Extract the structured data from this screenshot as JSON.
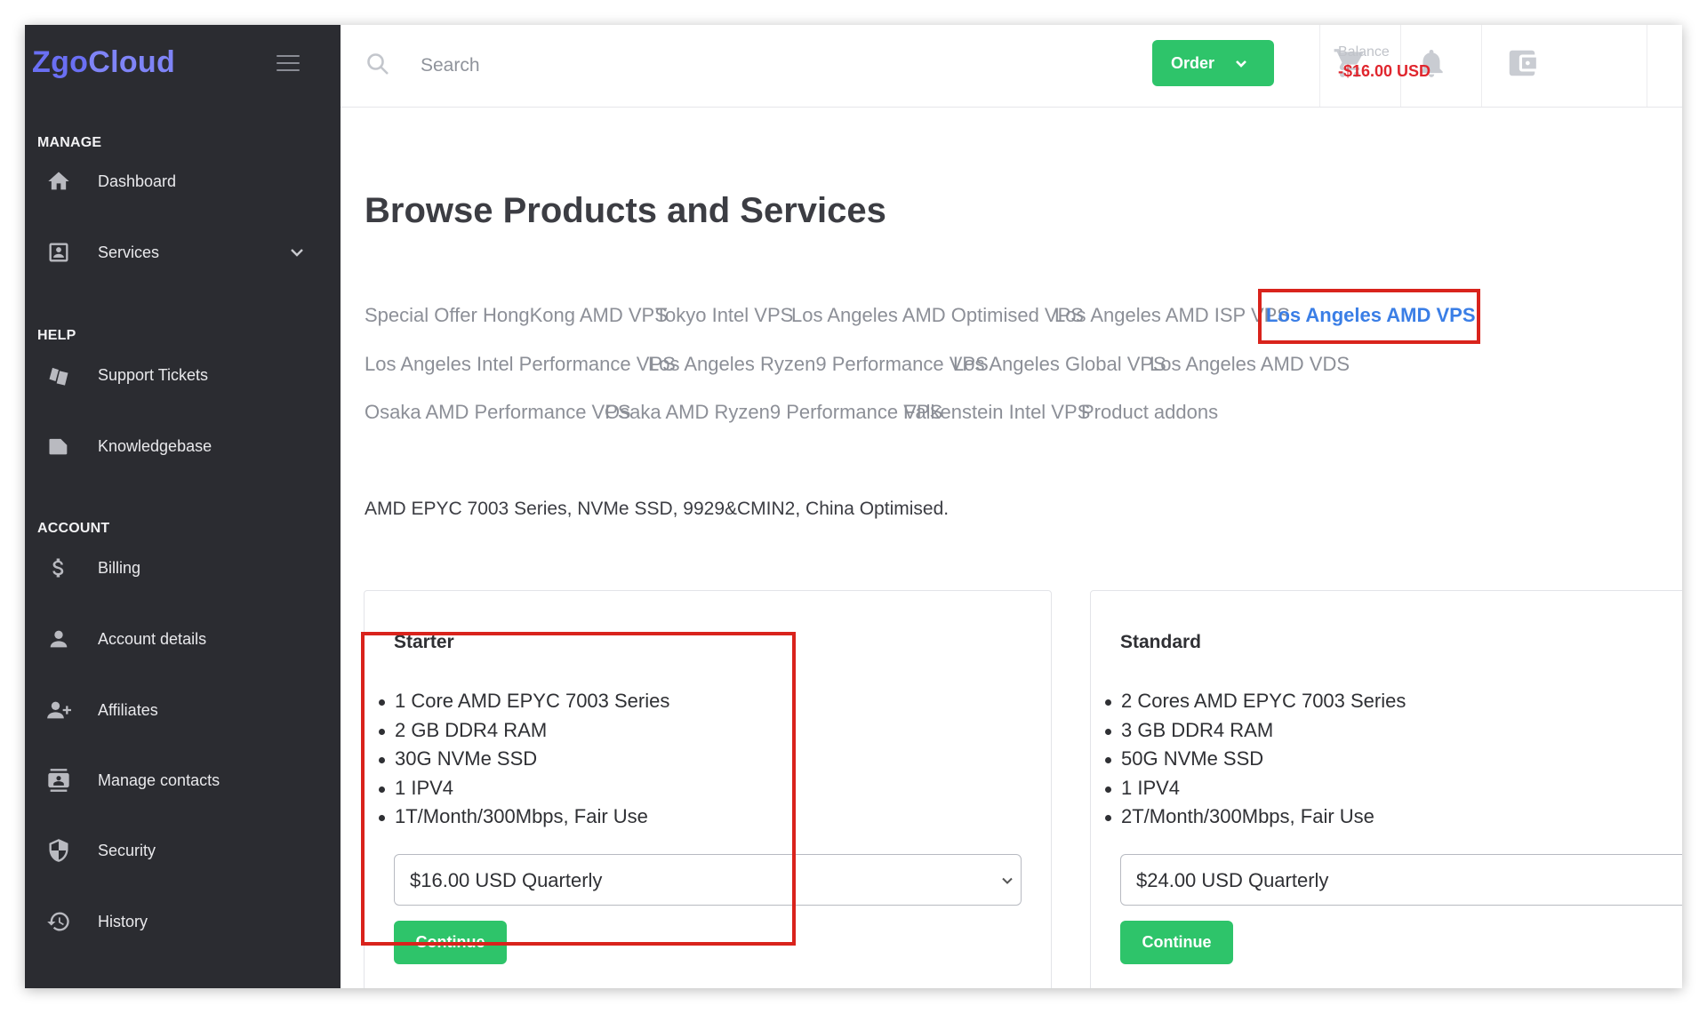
{
  "brand": {
    "part1": "Zgo",
    "part2": "Cloud"
  },
  "sidebar": {
    "sections": [
      {
        "title": "MANAGE",
        "items": [
          {
            "label": "Dashboard",
            "icon": "home-icon"
          },
          {
            "label": "Services",
            "icon": "id-card-icon",
            "has_submenu": true
          }
        ]
      },
      {
        "title": "HELP",
        "items": [
          {
            "label": "Support Tickets",
            "icon": "ticket-icon"
          },
          {
            "label": "Knowledgebase",
            "icon": "folder-icon"
          }
        ]
      },
      {
        "title": "ACCOUNT",
        "items": [
          {
            "label": "Billing",
            "icon": "dollar-icon"
          },
          {
            "label": "Account details",
            "icon": "user-icon"
          },
          {
            "label": "Affiliates",
            "icon": "user-plus-icon"
          },
          {
            "label": "Manage contacts",
            "icon": "contacts-icon"
          },
          {
            "label": "Security",
            "icon": "shield-icon"
          },
          {
            "label": "History",
            "icon": "history-icon"
          }
        ]
      }
    ]
  },
  "topbar": {
    "search_placeholder": "Search",
    "order_label": "Order",
    "balance_label": "Balance",
    "balance_value": "-$16.00 USD",
    "icons": [
      "search-icon",
      "cart-icon",
      "bell-icon",
      "wallet-icon"
    ]
  },
  "main": {
    "title": "Browse Products and Services",
    "categories": [
      "Special Offer",
      "HongKong AMD VPS",
      "Tokyo Intel VPS",
      "Los Angeles AMD Optimised VPS",
      "Los Angeles AMD ISP VPS",
      "Los Angeles AMD VPS",
      "Los Angeles Intel Performance VPS",
      "Los Angeles Ryzen9 Performance VPS",
      "Los Angeles Global VPS",
      "Los Angeles AMD VDS",
      "Osaka AMD Performance VPS",
      "Osaka AMD Ryzen9 Performance VPS",
      "Falkenstein Intel VPS",
      "Product addons"
    ],
    "active_category": "Los Angeles AMD VPS",
    "description": "AMD EPYC 7003 Series, NVMe SSD, 9929&CMIN2, China Optimised.",
    "products": [
      {
        "name": "Starter",
        "features": [
          "1 Core AMD EPYC 7003 Series",
          "2 GB DDR4 RAM",
          "30G NVMe SSD",
          "1 IPV4",
          "1T/Month/300Mbps, Fair Use"
        ],
        "selected_cycle": "$16.00 USD Quarterly",
        "button": "Continue"
      },
      {
        "name": "Standard",
        "features": [
          "2 Cores AMD EPYC 7003 Series",
          "3 GB DDR4 RAM",
          "50G NVMe SSD",
          "1 IPV4",
          "2T/Month/300Mbps, Fair Use"
        ],
        "selected_cycle": "$24.00 USD Quarterly",
        "button": "Continue"
      }
    ]
  },
  "colors": {
    "sidebar_bg": "#2b2c31",
    "brand": "#6a6ff3",
    "accent_green": "#2ec46a",
    "link_active": "#3a7ee6",
    "negative_balance": "#e0262e",
    "annotation_red": "#d9231c"
  }
}
